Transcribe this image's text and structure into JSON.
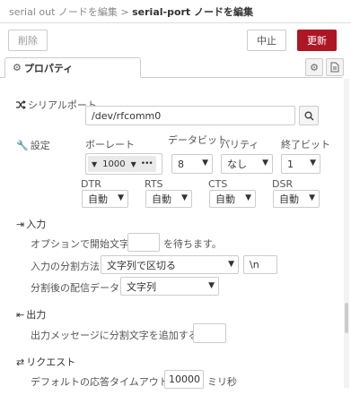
{
  "breadcrumb": {
    "parent": "serial out ノードを編集",
    "separator": ">",
    "current": "serial-port ノードを編集"
  },
  "toolbar": {
    "delete_label": "削除",
    "cancel_label": "中止",
    "update_label": "更新"
  },
  "tab": {
    "label": "プロパティ"
  },
  "serial": {
    "port_label": "シリアルポート",
    "port_value": "/dev/rfcomm0",
    "settings_label": "設定",
    "baud_label": "ボーレート",
    "baud_value": "1000",
    "databits_label": "データビット",
    "databits_value": "8",
    "parity_label": "パリティ",
    "parity_value": "なし",
    "stopbits_label": "終了ビット",
    "stopbits_value": "1",
    "dtr_label": "DTR",
    "dtr_value": "自動",
    "rts_label": "RTS",
    "rts_value": "自動",
    "cts_label": "CTS",
    "cts_value": "自動",
    "dsr_label": "DSR",
    "dsr_value": "自動"
  },
  "input": {
    "section_label": "入力",
    "start_prefix": "オプションで開始文字",
    "start_value": "",
    "start_suffix": "を待ちます。",
    "split_label": "入力の分割方法",
    "split_value": "文字列で区切る",
    "split_char": "\\n",
    "deliver_label": "分割後の配信データ",
    "deliver_value": "文字列"
  },
  "output": {
    "section_label": "出力",
    "add_char_label": "出力メッセージに分割文字を追加する",
    "add_char_value": ""
  },
  "request": {
    "section_label": "リクエスト",
    "timeout_label": "デフォルトの応答タイムアウト",
    "timeout_value": "10000",
    "timeout_unit": "ミリ秒"
  }
}
